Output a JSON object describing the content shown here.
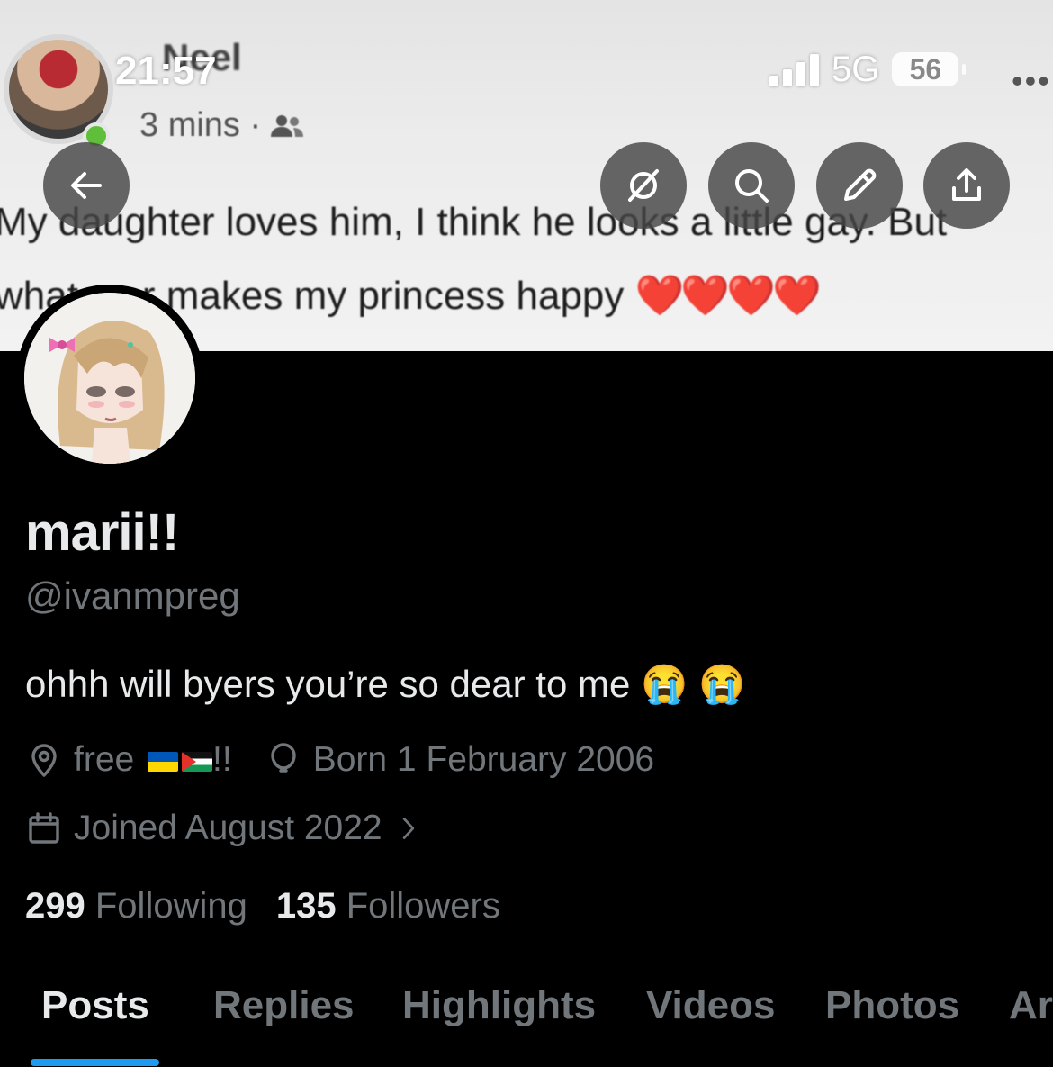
{
  "status_bar": {
    "time": "21:57",
    "network": "5G",
    "battery": "56"
  },
  "banner": {
    "poster_name": "Neel",
    "post_time": "3 mins ·",
    "caption_line1": "My daughter loves him, I think he looks a little gay. But",
    "caption_line2": "whatever makes my princess happy",
    "caption_emoji": "❤️❤️❤️❤️"
  },
  "header_buttons": {
    "back": "back-arrow-icon",
    "grok": "grok-icon",
    "search": "search-icon",
    "edit": "edit-pencil-icon",
    "share": "share-icon"
  },
  "profile": {
    "display_name": "marii!!",
    "handle": "@ivanmpreg",
    "bio": "ohhh will byers you’re so dear to me 😭 😭",
    "location_prefix": "free",
    "location_suffix": "!!",
    "birthday": "Born 1 February 2006",
    "joined": "Joined August 2022",
    "following_count": "299",
    "following_label": "Following",
    "followers_count": "135",
    "followers_label": "Followers"
  },
  "tabs": [
    "Posts",
    "Replies",
    "Highlights",
    "Videos",
    "Photos",
    "Ar"
  ],
  "active_tab": "Posts",
  "colors": {
    "accent": "#1d9bf0",
    "text": "#e7e9ea",
    "muted": "#71767b",
    "background": "#000000"
  }
}
